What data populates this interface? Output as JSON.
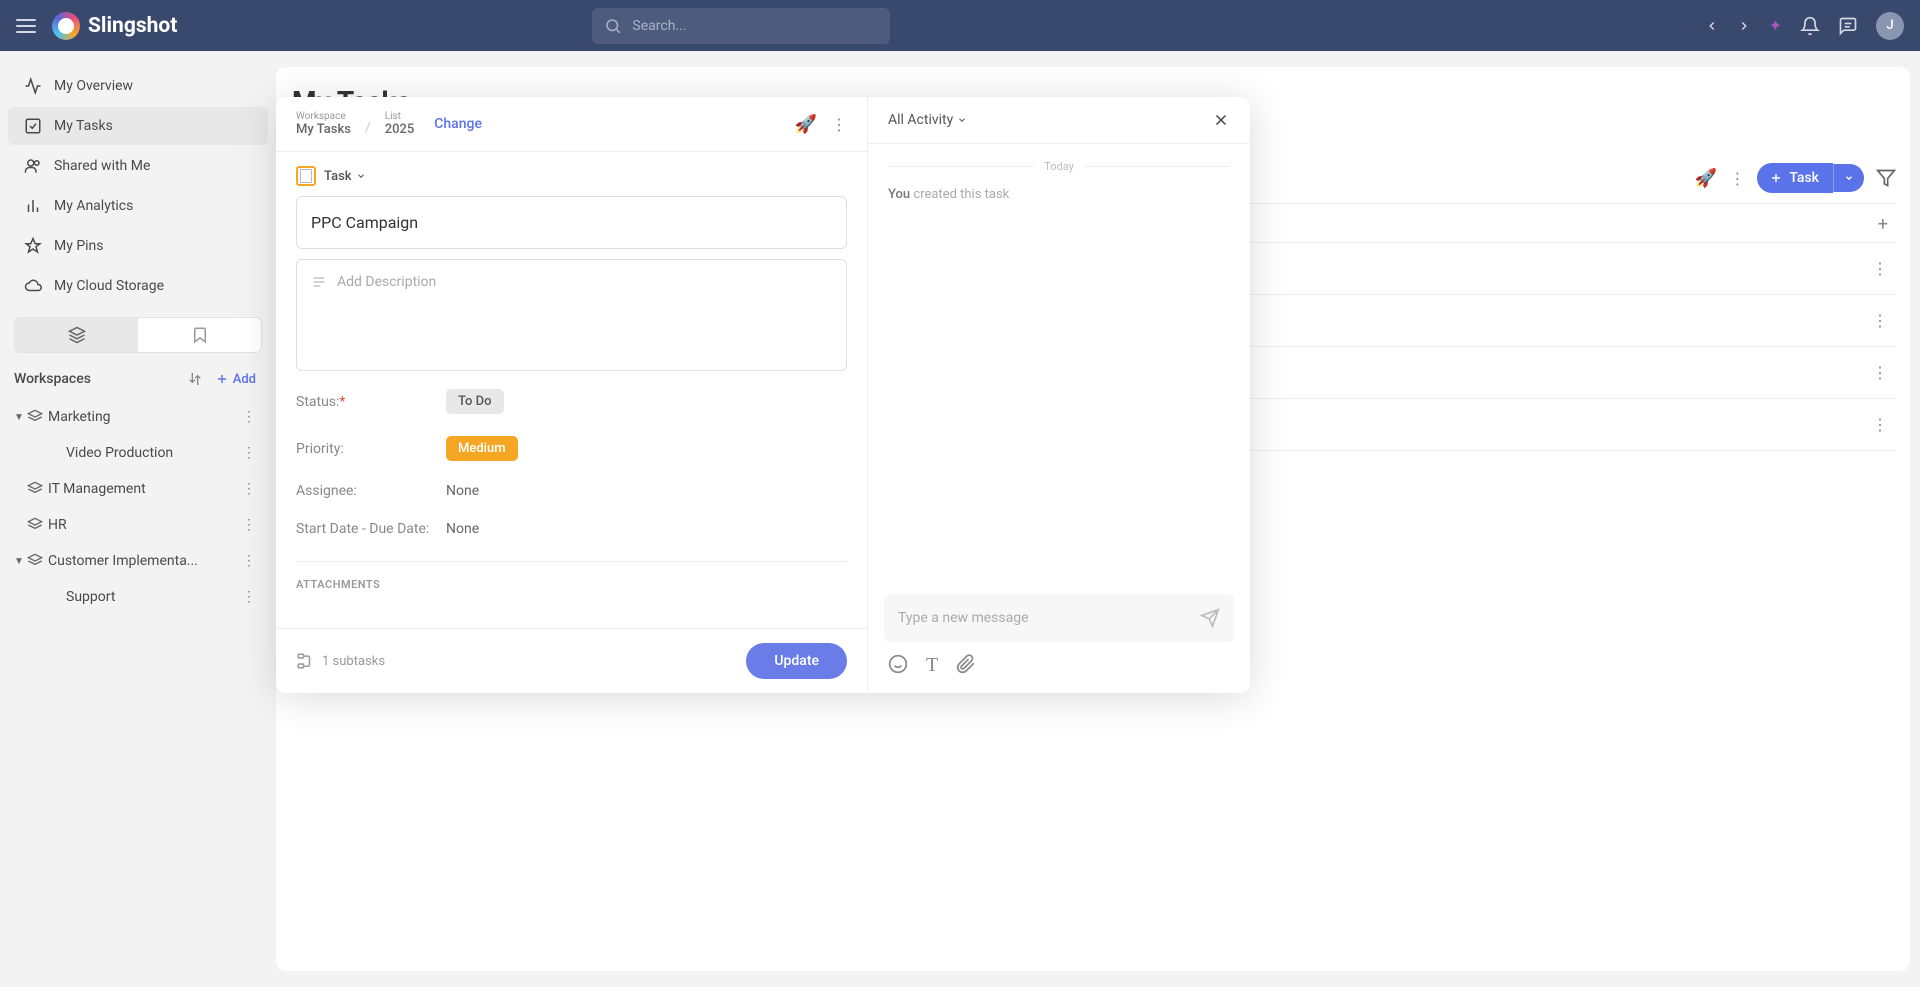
{
  "app": {
    "name": "Slingshot",
    "search_placeholder": "Search...",
    "avatar_initial": "J"
  },
  "sidebar": {
    "items": [
      {
        "label": "My Overview"
      },
      {
        "label": "My Tasks"
      },
      {
        "label": "Shared with Me"
      },
      {
        "label": "My Analytics"
      },
      {
        "label": "My Pins"
      },
      {
        "label": "My Cloud Storage"
      }
    ],
    "workspaces_label": "Workspaces",
    "add_label": "Add",
    "tree": {
      "marketing": "Marketing",
      "video_production": "Video Production",
      "it_management": "IT Management",
      "hr": "HR",
      "customer_impl": "Customer Implementa...",
      "support": "Support"
    }
  },
  "main": {
    "title": "My Tasks",
    "task_button": "Task"
  },
  "modal": {
    "breadcrumb": {
      "workspace_label": "Workspace",
      "workspace_value": "My Tasks",
      "list_label": "List",
      "list_value": "2025",
      "change": "Change"
    },
    "task_type": "Task",
    "title": "PPC Campaign",
    "description_placeholder": "Add Description",
    "fields": {
      "status_label": "Status:",
      "status_value": "To Do",
      "priority_label": "Priority:",
      "priority_value": "Medium",
      "assignee_label": "Assignee:",
      "assignee_value": "None",
      "dates_label": "Start Date - Due Date:",
      "dates_value": "None"
    },
    "attachments_label": "ATTACHMENTS",
    "subtasks": "1 subtasks",
    "update": "Update",
    "activity": {
      "dropdown": "All Activity",
      "today": "Today",
      "you": "You",
      "created": " created this task",
      "compose_placeholder": "Type a new message"
    }
  }
}
